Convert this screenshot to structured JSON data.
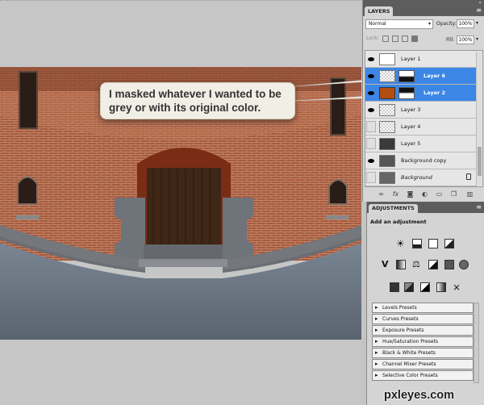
{
  "callout": {
    "text": "I masked whatever I wanted to be grey or with its original color."
  },
  "layers_panel": {
    "tab_label": "LAYERS",
    "blend_mode": "Normal",
    "opacity_label": "Opacity:",
    "opacity_value": "100%",
    "lock_label": "Lock:",
    "fill_label": "Fill:",
    "fill_value": "100%",
    "layers": [
      {
        "name": "Layer 1",
        "visible": true,
        "selected": false
      },
      {
        "name": "Layer 6",
        "visible": true,
        "selected": true
      },
      {
        "name": "Layer 2",
        "visible": true,
        "selected": true
      },
      {
        "name": "Layer 3",
        "visible": true,
        "selected": false
      },
      {
        "name": "Layer 4",
        "visible": false,
        "selected": false
      },
      {
        "name": "Layer 5",
        "visible": false,
        "selected": false
      },
      {
        "name": "Background copy",
        "visible": true,
        "selected": false
      },
      {
        "name": "Background",
        "visible": false,
        "selected": false
      }
    ]
  },
  "adjustments_panel": {
    "tab_label": "ADJUSTMENTS",
    "title": "Add an adjustment",
    "presets": [
      "Levels Presets",
      "Curves Presets",
      "Exposure Presets",
      "Hue/Saturation Presets",
      "Black & White Presets",
      "Channel Mixer Presets",
      "Selective Color Presets"
    ]
  },
  "watermark": {
    "text": "pxleyes.com"
  }
}
